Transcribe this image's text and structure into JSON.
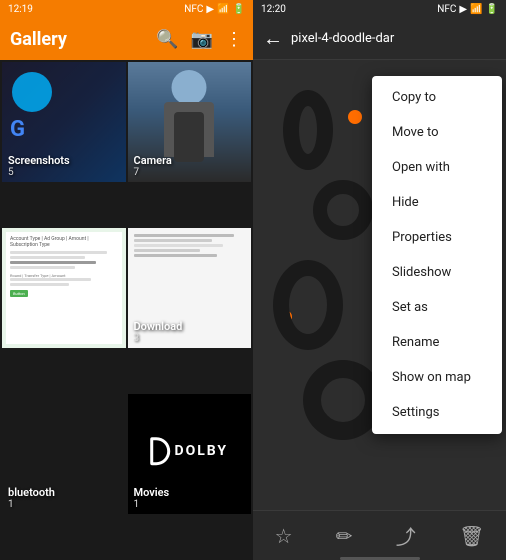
{
  "left": {
    "status_bar": {
      "time": "12:19",
      "icons": "NFC signal battery"
    },
    "app_title": "Gallery",
    "icons": {
      "search": "🔍",
      "camera": "📷",
      "more": "⋮"
    },
    "albums": [
      {
        "id": "screenshots",
        "label": "Screenshots",
        "count": "5"
      },
      {
        "id": "camera",
        "label": "Camera",
        "count": "7"
      },
      {
        "id": "doc",
        "label": "",
        "count": ""
      },
      {
        "id": "download",
        "label": "Download",
        "count": "3"
      },
      {
        "id": "bluetooth",
        "label": "bluetooth",
        "count": "1"
      },
      {
        "id": "movies",
        "label": "Movies",
        "count": "1"
      }
    ]
  },
  "right": {
    "status_bar": {
      "time": "12:20",
      "icons": "NFC signal battery"
    },
    "file_title": "pixel-4-doodle-dar",
    "context_menu": {
      "items": [
        "Copy to",
        "Move to",
        "Open with",
        "Hide",
        "Properties",
        "Slideshow",
        "Set as",
        "Rename",
        "Show on map",
        "Settings"
      ]
    },
    "toolbar": {
      "star": "☆",
      "edit": "✏",
      "share": "⤴",
      "delete": "🗑"
    }
  }
}
